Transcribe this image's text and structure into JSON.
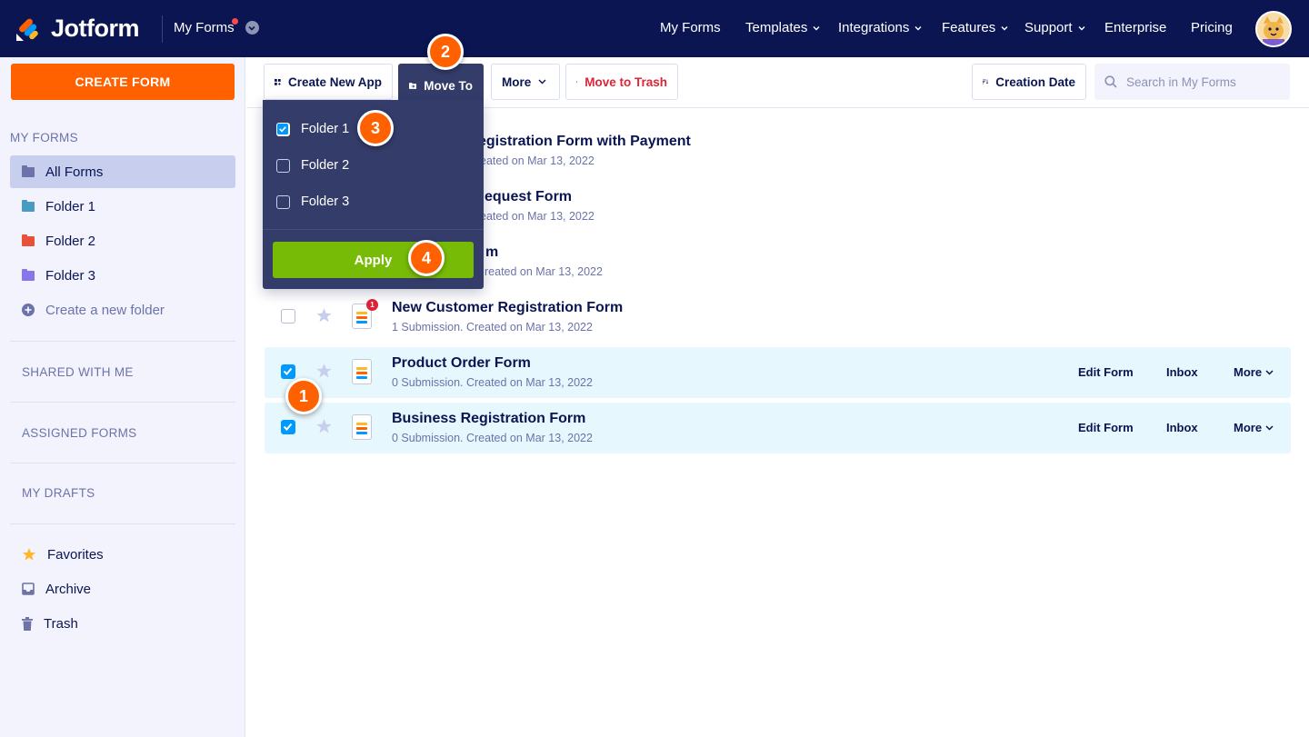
{
  "brand": {
    "name": "Jotform"
  },
  "topnav": {
    "switcher": "My Forms",
    "links": [
      "My Forms",
      "Templates",
      "Integrations",
      "Features",
      "Support",
      "Enterprise",
      "Pricing"
    ]
  },
  "sidebar": {
    "create_label": "CREATE FORM",
    "my_forms_heading": "MY FORMS",
    "items": [
      {
        "label": "All Forms",
        "color": "#6c73a8"
      },
      {
        "label": "Folder 1",
        "color": "#4a9bc2"
      },
      {
        "label": "Folder 2",
        "color": "#e8503a"
      },
      {
        "label": "Folder 3",
        "color": "#8a75e8"
      }
    ],
    "create_folder": "Create a new folder",
    "shared": "SHARED WITH ME",
    "assigned": "ASSIGNED FORMS",
    "drafts": "MY DRAFTS",
    "favorites": "Favorites",
    "archive": "Archive",
    "trash": "Trash"
  },
  "toolbar": {
    "create_app": "Create New App",
    "move_to": "Move To",
    "more": "More",
    "move_trash": "Move to Trash",
    "sort": "Creation Date",
    "search_placeholder": "Search in My Forms"
  },
  "dropdown": {
    "folders": [
      {
        "label": "Folder 1",
        "checked": true
      },
      {
        "label": "Folder 2",
        "checked": false
      },
      {
        "label": "Folder 3",
        "checked": false
      }
    ],
    "apply": "Apply"
  },
  "forms": [
    {
      "title": "Registration Form with Payment",
      "title_visible": "egistration Form with Payment",
      "sub_visible": "eated on Mar 13, 2022"
    },
    {
      "title": "Request Form",
      "title_visible": "equest Form",
      "sub_visible": "eated on Mar 13, 2022"
    },
    {
      "title": "Form",
      "title_visible": "m",
      "sub_visible": "reated on Mar 13, 2022"
    },
    {
      "title": "New Customer Registration Form",
      "sub": "1 Submission. Created on Mar 13, 2022",
      "badge": "1"
    },
    {
      "title": "Product Order Form",
      "sub": "0 Submission. Created on Mar 13, 2022",
      "selected": true
    },
    {
      "title": "Business Registration Form",
      "sub": "0 Submission. Created on Mar 13, 2022",
      "selected": true
    }
  ],
  "row_actions": {
    "edit": "Edit Form",
    "inbox": "Inbox",
    "more": "More"
  },
  "markers": [
    "1",
    "2",
    "3",
    "4"
  ],
  "colors": {
    "nav": "#0a1551",
    "orange": "#ff6100",
    "green": "#78bb07",
    "check": "#0099ff",
    "dropdown": "#343c6a"
  }
}
